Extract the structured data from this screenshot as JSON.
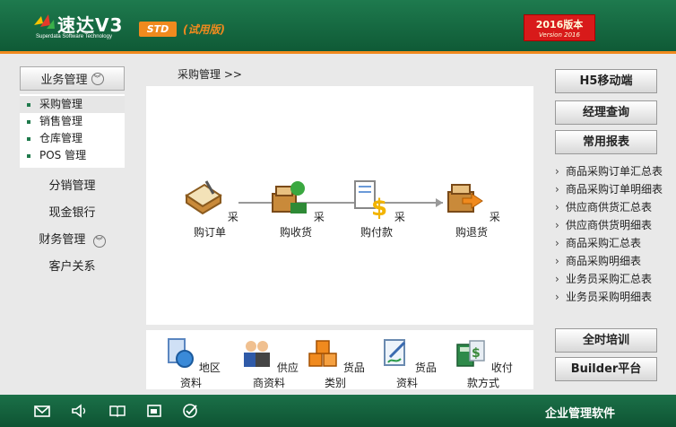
{
  "header": {
    "logo_text": "速达V3",
    "logo_sub": "Superdata Software Technology",
    "edition": "STD",
    "trial": "(试用版)",
    "version_line1": "2016版本",
    "version_line2": "Version 2016"
  },
  "left": {
    "business": "业务管理",
    "sub": [
      "采购管理",
      "销售管理",
      "仓库管理",
      "POS 管理"
    ],
    "distribution": "分销管理",
    "cash": "现金银行",
    "finance": "财务管理",
    "crm": "客户关系"
  },
  "breadcrumb": "采购管理  >>",
  "flow": {
    "steps": [
      "采购订单",
      "采购收货",
      "采购付款",
      "采购退货"
    ]
  },
  "tools": [
    "地区资料",
    "供应商资料",
    "货品类别",
    "货品资料",
    "收付款方式"
  ],
  "right": {
    "h5": "H5移动端",
    "manager": "经理查询",
    "common_reports": "常用报表",
    "reports": [
      "商品采购订单汇总表",
      "商品采购订单明细表",
      "供应商供货汇总表",
      "供应商供货明细表",
      "商品采购汇总表",
      "商品采购明细表",
      "业务员采购汇总表",
      "业务员采购明细表"
    ],
    "training": "全时培训",
    "builder": "Builder平台"
  },
  "footer": {
    "brand": "企业管理软件"
  },
  "colors": {
    "header_green": "#1e7a4e",
    "accent_orange": "#f08a1e",
    "version_red": "#d81a1a"
  }
}
